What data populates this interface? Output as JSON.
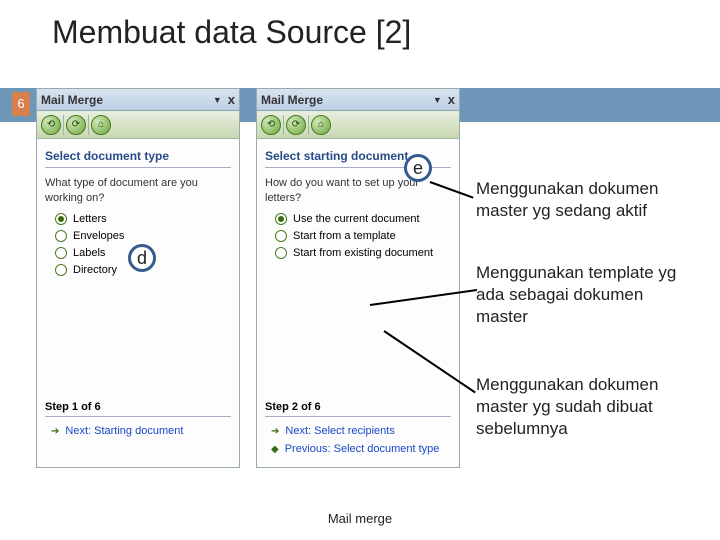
{
  "slide": {
    "title": "Membuat data Source [2]",
    "number": "6",
    "footer": "Mail merge"
  },
  "pane1": {
    "header": "Mail Merge",
    "section": "Select document type",
    "prompt": "What type of document are you working on?",
    "options": [
      "Letters",
      "Envelopes",
      "Labels",
      "Directory"
    ],
    "step": "Step 1 of 6",
    "next": "Next: Starting document"
  },
  "pane2": {
    "header": "Mail Merge",
    "section": "Select starting document",
    "prompt": "How do you want to set up your letters?",
    "options": [
      "Use the current document",
      "Start from a template",
      "Start from existing document"
    ],
    "step": "Step 2 of 6",
    "next": "Next: Select recipients",
    "prev": "Previous: Select document type"
  },
  "callouts": {
    "d": "d",
    "e": "e"
  },
  "annotations": {
    "a1": "Menggunakan dokumen master yg sedang aktif",
    "a2": "Menggunakan template yg ada sebagai dokumen master",
    "a3": "Menggunakan dokumen master yg sudah dibuat sebelumnya"
  }
}
